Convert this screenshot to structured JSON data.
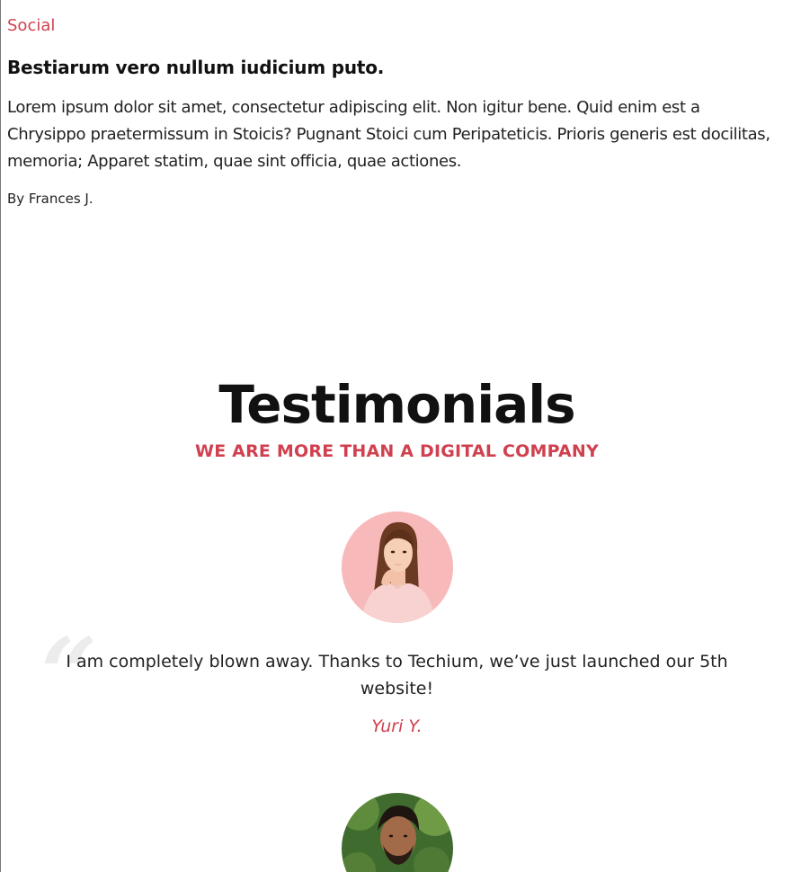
{
  "post": {
    "category": "Social",
    "title": "Bestiarum vero nullum iudicium puto.",
    "excerpt": "Lorem ipsum dolor sit amet, consectetur adipiscing elit. Non igitur bene. Quid enim est a Chrysippo praetermissum in Stoicis? Pugnant Stoici cum Peripateticis. Prioris generis est docilitas, memoria; Apparet statim, quae sint officia, quae actiones.",
    "byline": "By Frances J."
  },
  "testimonials": {
    "title": "Testimonials",
    "subtitle": "WE ARE MORE THAN A DIGITAL COMPANY",
    "items": [
      {
        "quote": "I am completely blown away. Thanks to Techium, we’ve just launched our 5th website!",
        "author": "Yuri Y."
      }
    ]
  },
  "colors": {
    "accent": "#d0404f",
    "heading": "#111111",
    "text": "#222222",
    "quote_mark": "#ececec"
  },
  "icons": {
    "quote_mark": "quote-mark-icon"
  }
}
